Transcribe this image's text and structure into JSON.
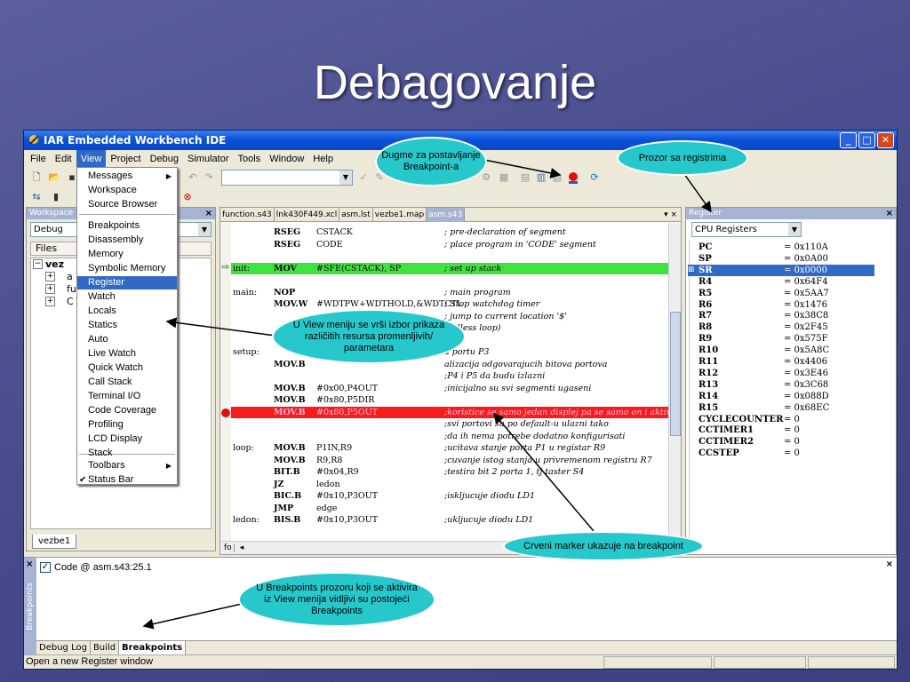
{
  "slide": {
    "title": "Debagovanje"
  },
  "window": {
    "title": "IAR Embedded Workbench IDE"
  },
  "menubar": [
    "File",
    "Edit",
    "View",
    "Project",
    "Debug",
    "Simulator",
    "Tools",
    "Window",
    "Help"
  ],
  "view_menu": {
    "items": [
      {
        "label": "Messages",
        "submenu": true
      },
      {
        "label": "Workspace"
      },
      {
        "label": "Source Browser"
      },
      {
        "label": "Breakpoints"
      },
      {
        "label": "Disassembly"
      },
      {
        "label": "Memory"
      },
      {
        "label": "Symbolic Memory"
      },
      {
        "label": "Register",
        "highlighted": true
      },
      {
        "label": "Watch"
      },
      {
        "label": "Locals"
      },
      {
        "label": "Statics"
      },
      {
        "label": "Auto"
      },
      {
        "label": "Live Watch"
      },
      {
        "label": "Quick Watch"
      },
      {
        "label": "Call Stack"
      },
      {
        "label": "Terminal I/O"
      },
      {
        "label": "Code Coverage"
      },
      {
        "label": "Profiling"
      },
      {
        "label": "LCD Display"
      },
      {
        "label": "Stack"
      },
      {
        "label": "Toolbars",
        "submenu": true
      },
      {
        "label": "Status Bar",
        "checked": true
      }
    ]
  },
  "workspace": {
    "pane_title": "Workspace",
    "config": "Debug",
    "files_header": "Files",
    "tree": [
      "vez",
      "a",
      "fu",
      "C"
    ],
    "tab": "vezbe1"
  },
  "editor": {
    "tabs": [
      "function.s43",
      "lnk430F449.xcl",
      "asm.lst",
      "vezbe1.map",
      "asm.s43"
    ],
    "active_tab": "asm.s43",
    "bottom_label": "fo",
    "lines": [
      {
        "label": "",
        "instr": "RSEG",
        "operand": "CSTACK",
        "comment": "; pre-declaration of segment"
      },
      {
        "label": "",
        "instr": "RSEG",
        "operand": "CODE",
        "comment": "; place program in 'CODE' segment"
      },
      {
        "label": "",
        "instr": "",
        "operand": "",
        "comment": ""
      },
      {
        "label": "init:",
        "instr": "MOV",
        "operand": "#SFE(CSTACK), SP",
        "comment": "; set up stack",
        "mark": "pc"
      },
      {
        "label": "",
        "instr": "",
        "operand": "",
        "comment": ""
      },
      {
        "label": "main:",
        "instr": "NOP",
        "operand": "",
        "comment": "; main program"
      },
      {
        "label": "",
        "instr": "MOV.W",
        "operand": "#WDTPW+WDTHOLD,&WDTCTL",
        "comment": "; Stop watchdog timer"
      },
      {
        "label": "",
        "instr": "",
        "operand": "",
        "comment": "; jump to current location '$'"
      },
      {
        "label": "",
        "instr": "",
        "operand": "",
        "comment": "endless loop)"
      },
      {
        "label": "",
        "instr": "",
        "operand": "",
        "comment": ""
      },
      {
        "label": "setup:",
        "instr": "",
        "operand": "",
        "comment": "a portu P3"
      },
      {
        "label": "",
        "instr": "MOV.B",
        "operand": "",
        "comment": "alizacija odgovarajucih bitova portova"
      },
      {
        "label": "",
        "instr": "",
        "operand": "",
        "comment": ";P4 i P5 da budu izlazni"
      },
      {
        "label": "",
        "instr": "MOV.B",
        "operand": "#0x00,P4OUT",
        "comment": ";inicijalno su svi segmenti ugaseni"
      },
      {
        "label": "",
        "instr": "MOV.B",
        "operand": "#0x80,P5DIR",
        "comment": ""
      },
      {
        "label": "",
        "instr": "MOV.B",
        "operand": "#0x80,P5OUT",
        "comment": ";koristice se samo jedan displej pa se samo on i aktiv",
        "mark": "bp"
      },
      {
        "label": "",
        "instr": "",
        "operand": "",
        "comment": ";svi portovi su po default-u ulazni tako"
      },
      {
        "label": "",
        "instr": "",
        "operand": "",
        "comment": ";da ih nema potrebe dodatno konfigurisati"
      },
      {
        "label": "loop:",
        "instr": "MOV.B",
        "operand": "P1IN,R9",
        "comment": ";ucitava stanje porta P1 u registar R9"
      },
      {
        "label": "",
        "instr": "MOV.B",
        "operand": "R9,R8",
        "comment": ";cuvanje istog stanja u privremenom registru R7"
      },
      {
        "label": "",
        "instr": "BIT.B",
        "operand": "#0x04,R9",
        "comment": ";testira bit 2 porta 1, tj taster S4"
      },
      {
        "label": "",
        "instr": "JZ",
        "operand": "ledon",
        "comment": ""
      },
      {
        "label": "",
        "instr": "BIC.B",
        "operand": "#0x10,P3OUT",
        "comment": ";iskljucuje diodu LD1"
      },
      {
        "label": "",
        "instr": "JMP",
        "operand": "edge",
        "comment": ""
      },
      {
        "label": "ledon:",
        "instr": "BIS.B",
        "operand": "#0x10,P3OUT",
        "comment": ";ukljucuje diodu LD1"
      }
    ]
  },
  "registers": {
    "pane_title": "Register",
    "group": "CPU Registers",
    "rows": [
      {
        "name": "PC",
        "value": "= 0x110A"
      },
      {
        "name": "SP",
        "value": "= 0x0A00"
      },
      {
        "name": "SR",
        "value": "= 0x0000",
        "selected": true,
        "expandable": true
      },
      {
        "name": "R4",
        "value": "= 0x64F4"
      },
      {
        "name": "R5",
        "value": "= 0x5AA7"
      },
      {
        "name": "R6",
        "value": "= 0x1476"
      },
      {
        "name": "R7",
        "value": "= 0x38C8"
      },
      {
        "name": "R8",
        "value": "= 0x2F45"
      },
      {
        "name": "R9",
        "value": "= 0x575F"
      },
      {
        "name": "R10",
        "value": "= 0x5A8C"
      },
      {
        "name": "R11",
        "value": "= 0x4406"
      },
      {
        "name": "R12",
        "value": "= 0x3E46"
      },
      {
        "name": "R13",
        "value": "= 0x3C68"
      },
      {
        "name": "R14",
        "value": "= 0x088D"
      },
      {
        "name": "R15",
        "value": "= 0x68EC"
      },
      {
        "name": "CYCLECOUNTER",
        "value": "= 0"
      },
      {
        "name": "CCTIMER1",
        "value": "= 0"
      },
      {
        "name": "CCTIMER2",
        "value": "= 0"
      },
      {
        "name": "CCSTEP",
        "value": "= 0"
      }
    ]
  },
  "breakpoints": {
    "side_label": "Breakpoints",
    "entry": "Code @ asm.s43:25.1",
    "tabs": [
      "Debug Log",
      "Build",
      "Breakpoints"
    ],
    "active_tab": "Breakpoints"
  },
  "statusbar": {
    "text": "Open a new Register window"
  },
  "callouts": {
    "breakpoint_button": "Dugme za postavljanje Breakpoint-a",
    "register_window": "Prozor sa registrima",
    "view_menu": "U View meniju se vrši izbor prikaza različitih resursa promenljivih/ parametara",
    "red_marker": "Crveni marker ukazuje na breakpoint",
    "breakpoints_window": "U Breakpoints prozoru koji se aktivira iz View menija vidljivi su postojeći Breakpoints"
  },
  "colors": {
    "slide_background": "#4a4e8e",
    "callout": "#27c8cc",
    "pc_highlight": "#3fe33f",
    "breakpoint_highlight": "#f51d1d",
    "selection": "#316ac5"
  }
}
